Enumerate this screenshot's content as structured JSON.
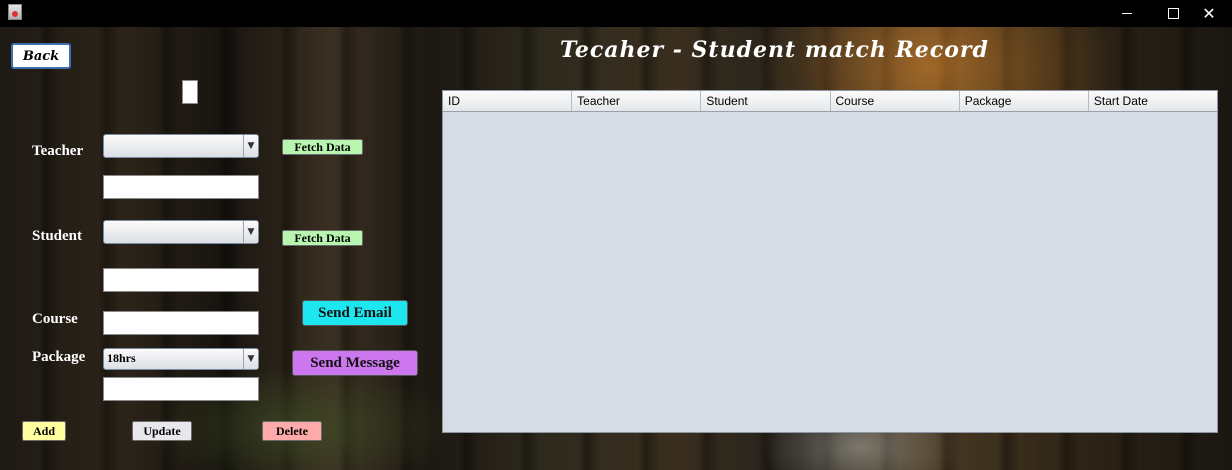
{
  "window": {
    "icon": "java-cup-icon",
    "controls": {
      "minimize": "minimize-icon",
      "maximize": "maximize-icon",
      "close": "✕"
    }
  },
  "header": {
    "back_label": "Back",
    "title": "Tecaher - Student match Record"
  },
  "form": {
    "teacher_label": "Teacher",
    "student_label": "Student",
    "course_label": "Course",
    "package_label": "Package",
    "teacher_select_value": "",
    "student_select_value": "",
    "package_select_value": "18hrs",
    "teacher_name_value": "",
    "student_name_value": "",
    "course_value": "",
    "package_detail_value": "",
    "id_value": ""
  },
  "buttons": {
    "fetch_teacher": "Fetch Data",
    "fetch_student": "Fetch Data",
    "send_email": "Send Email",
    "send_message": "Send Message",
    "add": "Add",
    "update": "Update",
    "delete": "Delete"
  },
  "colors": {
    "fetch": "#b8f5b0",
    "send_email": "#1ee6ee",
    "send_message": "#cc77ee",
    "add": "#ffffa0",
    "update": "#e8e8ec",
    "delete": "#ffaaaa"
  },
  "table": {
    "columns": [
      "ID",
      "Teacher",
      "Student",
      "Course",
      "Package",
      "Start Date"
    ],
    "rows": []
  }
}
